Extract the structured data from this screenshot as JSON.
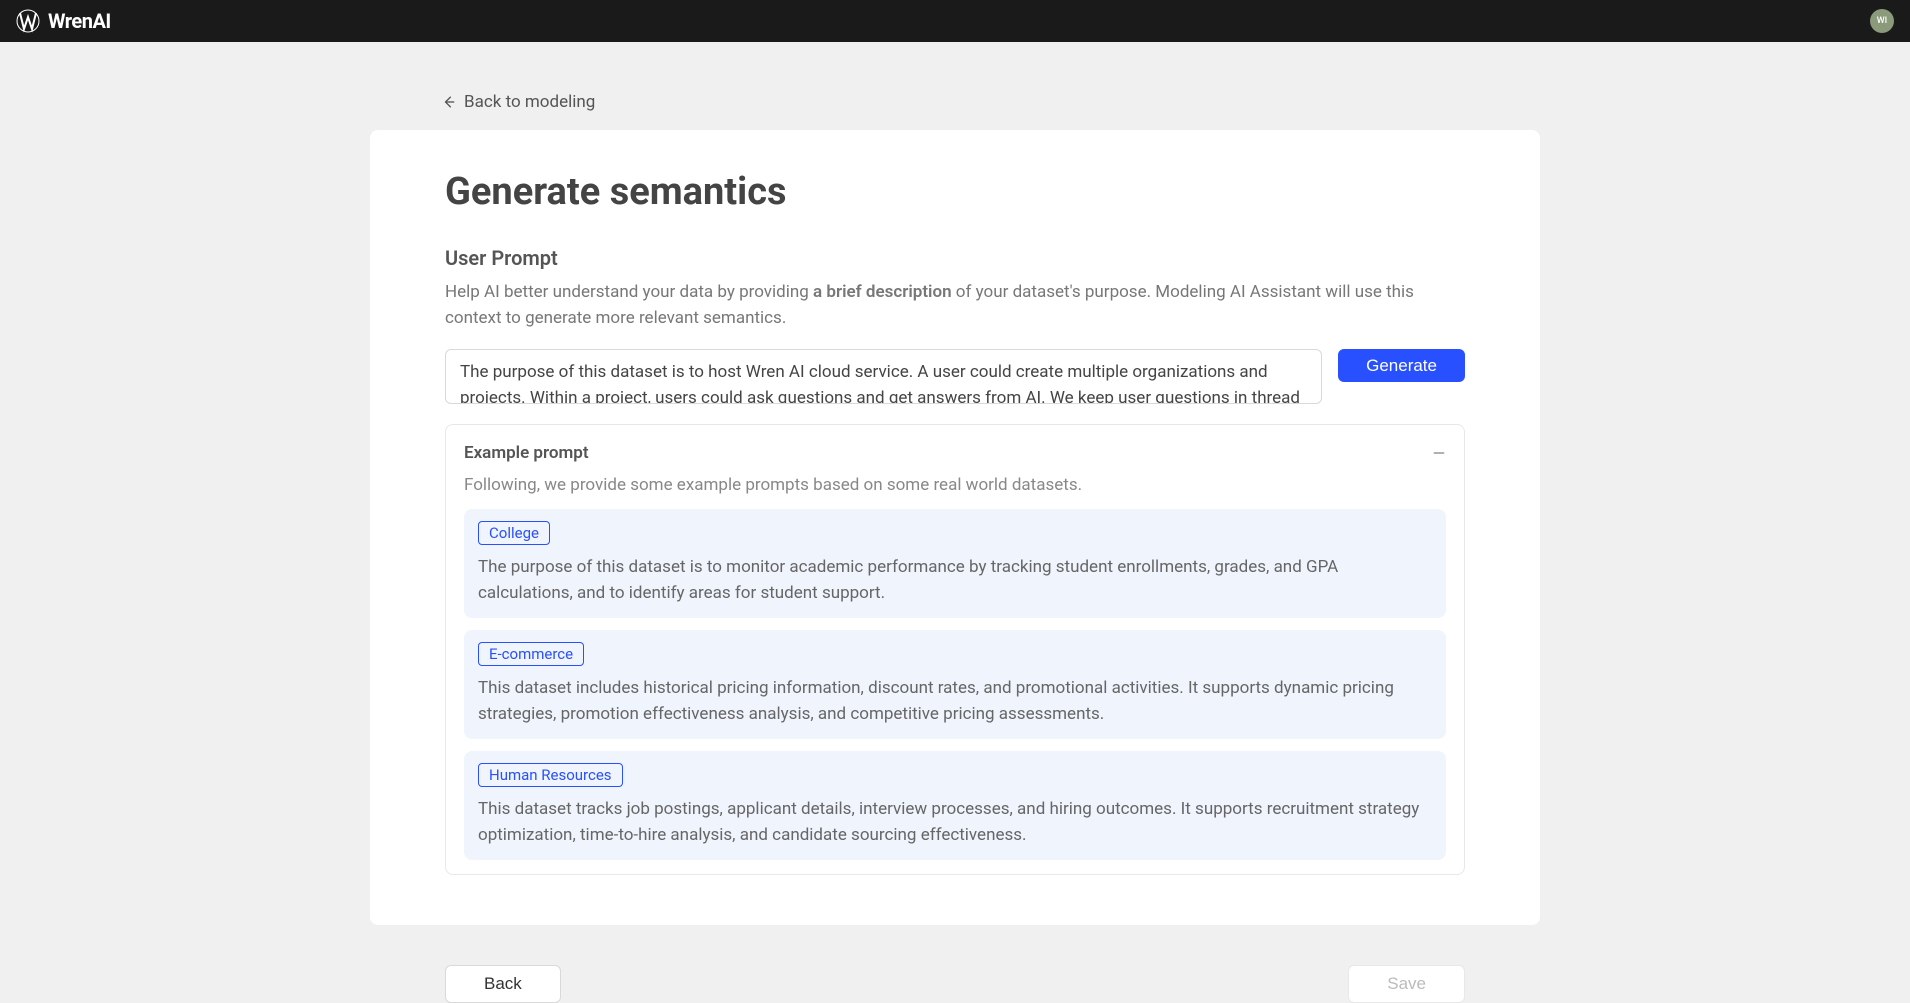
{
  "header": {
    "logo_text": "WrenAI",
    "avatar_initials": "WI"
  },
  "nav": {
    "back_label": "Back to modeling"
  },
  "page": {
    "title": "Generate semantics",
    "section_title": "User Prompt",
    "desc_part1": "Help AI better understand your data by providing ",
    "desc_bold": "a brief description",
    "desc_part2": " of your dataset's purpose. Modeling AI Assistant will use this context to generate more relevant semantics.",
    "prompt_value": "The purpose of this dataset is to host Wren AI cloud service. A user could create multiple organizations and projects. Within a project, users could ask questions and get answers from AI. We keep user questions in thread response.",
    "generate_label": "Generate"
  },
  "examples": {
    "header": "Example prompt",
    "subdesc": "Following, we provide some example prompts based on some real world datasets.",
    "items": [
      {
        "tag": "College",
        "text": "The purpose of this dataset is to monitor academic performance by tracking student enrollments, grades, and GPA calculations, and to identify areas for student support."
      },
      {
        "tag": "E-commerce",
        "text": "This dataset includes historical pricing information, discount rates, and promotional activities. It supports dynamic pricing strategies, promotion effectiveness analysis, and competitive pricing assessments."
      },
      {
        "tag": "Human Resources",
        "text": "This dataset tracks job postings, applicant details, interview processes, and hiring outcomes. It supports recruitment strategy optimization, time-to-hire analysis, and candidate sourcing effectiveness."
      }
    ]
  },
  "footer": {
    "back_label": "Back",
    "save_label": "Save"
  }
}
